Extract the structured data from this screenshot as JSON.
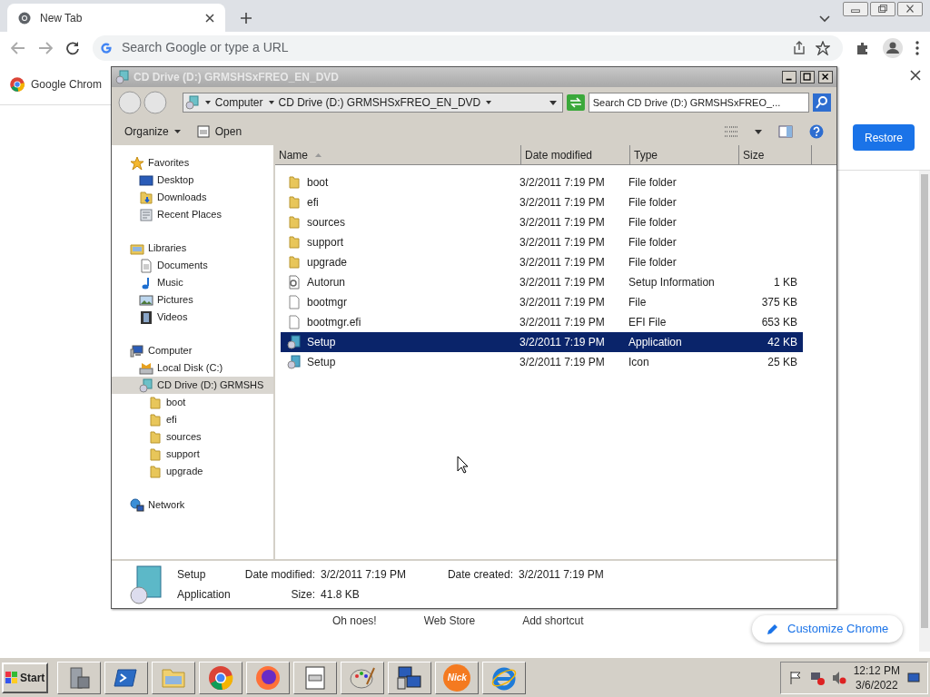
{
  "chrome": {
    "tab": {
      "title": "New Tab",
      "selected": true
    },
    "omnibox": {
      "placeholder": "Search Google or type a URL"
    },
    "bookmark": {
      "label": "Google Chrom"
    },
    "restore_button": "Restore",
    "shortcuts": [
      "Oh noes!",
      "Web Store",
      "Add shortcut"
    ],
    "customize_button": "Customize Chrome"
  },
  "explorer": {
    "title": "CD Drive (D:) GRMSHSxFREO_EN_DVD",
    "breadcrumb": [
      "Computer",
      "CD Drive (D:) GRMSHSxFREO_EN_DVD"
    ],
    "search": {
      "placeholder": "Search CD Drive (D:) GRMSHSxFREO_..."
    },
    "toolbar": [
      {
        "label": "Organize",
        "kind": "menu"
      },
      {
        "label": "Open",
        "kind": "open"
      }
    ],
    "nav": [
      {
        "label": "Favorites",
        "kind": "star",
        "selected": false,
        "children": [
          {
            "label": "Desktop",
            "kind": "desktop",
            "selected": false
          },
          {
            "label": "Downloads",
            "kind": "downloads",
            "selected": false
          },
          {
            "label": "Recent Places",
            "kind": "recent",
            "selected": false
          }
        ]
      },
      {
        "label": "Libraries",
        "kind": "library",
        "selected": false,
        "children": [
          {
            "label": "Documents",
            "kind": "document",
            "selected": false
          },
          {
            "label": "Music",
            "kind": "music",
            "selected": false
          },
          {
            "label": "Pictures",
            "kind": "pictures",
            "selected": false
          },
          {
            "label": "Videos",
            "kind": "videos",
            "selected": false
          }
        ]
      },
      {
        "label": "Computer",
        "kind": "computer",
        "selected": false,
        "children": [
          {
            "label": "Local Disk (C:)",
            "kind": "disk",
            "selected": false
          },
          {
            "label": "CD Drive (D:) GRMSHS",
            "kind": "cd",
            "selected": true,
            "children": [
              {
                "label": "boot",
                "kind": "folder",
                "selected": false
              },
              {
                "label": "efi",
                "kind": "folder",
                "selected": false
              },
              {
                "label": "sources",
                "kind": "folder",
                "selected": false
              },
              {
                "label": "support",
                "kind": "folder",
                "selected": false
              },
              {
                "label": "upgrade",
                "kind": "folder",
                "selected": false
              }
            ]
          }
        ]
      },
      {
        "label": "Network",
        "kind": "network",
        "selected": false
      }
    ],
    "columns": [
      {
        "label": "Name",
        "sorted": true
      },
      {
        "label": "Date modified",
        "sorted": false
      },
      {
        "label": "Type",
        "sorted": false
      },
      {
        "label": "Size",
        "sorted": false
      }
    ],
    "rows": [
      {
        "name": "boot",
        "kind": "folder",
        "date": "3/2/2011 7:19 PM",
        "type": "File folder",
        "size": "",
        "selected": false
      },
      {
        "name": "efi",
        "kind": "folder",
        "date": "3/2/2011 7:19 PM",
        "type": "File folder",
        "size": "",
        "selected": false
      },
      {
        "name": "sources",
        "kind": "folder",
        "date": "3/2/2011 7:19 PM",
        "type": "File folder",
        "size": "",
        "selected": false
      },
      {
        "name": "support",
        "kind": "folder",
        "date": "3/2/2011 7:19 PM",
        "type": "File folder",
        "size": "",
        "selected": false
      },
      {
        "name": "upgrade",
        "kind": "folder",
        "date": "3/2/2011 7:19 PM",
        "type": "File folder",
        "size": "",
        "selected": false
      },
      {
        "name": "Autorun",
        "kind": "settings",
        "date": "3/2/2011 7:19 PM",
        "type": "Setup Information",
        "size": "1 KB",
        "selected": false
      },
      {
        "name": "bootmgr",
        "kind": "file",
        "date": "3/2/2011 7:19 PM",
        "type": "File",
        "size": "375 KB",
        "selected": false
      },
      {
        "name": "bootmgr.efi",
        "kind": "file",
        "date": "3/2/2011 7:19 PM",
        "type": "EFI File",
        "size": "653 KB",
        "selected": false
      },
      {
        "name": "Setup",
        "kind": "app",
        "date": "3/2/2011 7:19 PM",
        "type": "Application",
        "size": "42 KB",
        "selected": true
      },
      {
        "name": "Setup",
        "kind": "app",
        "date": "3/2/2011 7:19 PM",
        "type": "Icon",
        "size": "25 KB",
        "selected": false
      }
    ],
    "details": {
      "name": "Setup",
      "type": "Application",
      "modified_label": "Date modified:",
      "modified": "3/2/2011 7:19 PM",
      "created_label": "Date created:",
      "created": "3/2/2011 7:19 PM",
      "size_label": "Size:",
      "size": "41.8 KB"
    }
  },
  "taskbar": {
    "start": "Start",
    "apps": [
      {
        "kind": "server"
      },
      {
        "kind": "shell"
      },
      {
        "kind": "folder"
      },
      {
        "kind": "chrome"
      },
      {
        "kind": "firefox"
      },
      {
        "kind": "notepad"
      },
      {
        "kind": "paint"
      },
      {
        "kind": "network"
      },
      {
        "kind": "nick",
        "label": "Nick"
      },
      {
        "kind": "ie"
      }
    ],
    "time": "12:12 PM",
    "date": "3/6/2022"
  }
}
